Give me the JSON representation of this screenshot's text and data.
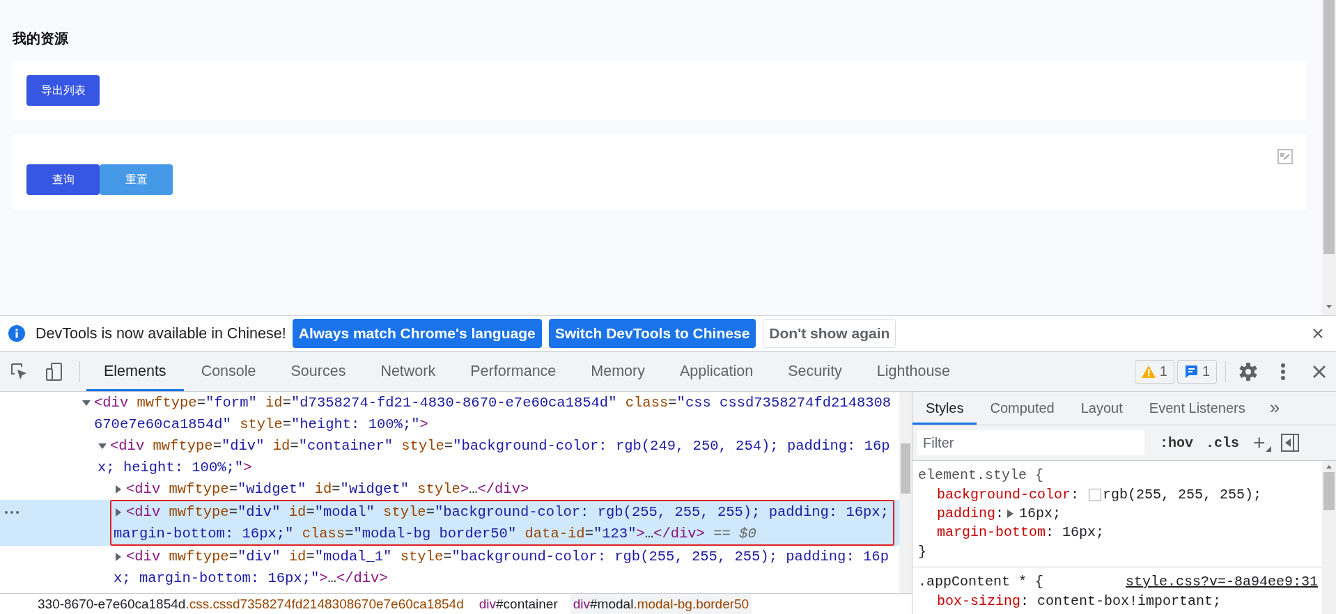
{
  "page": {
    "title": "我的资源",
    "toolbar_buttons": [
      {
        "label": "导出列表",
        "kind": "primary"
      }
    ],
    "search_panel": {
      "buttons": [
        {
          "label": "查询",
          "kind": "primary"
        },
        {
          "label": "重置",
          "kind": "secondary"
        }
      ]
    }
  },
  "devtools": {
    "banner": {
      "message": "DevTools is now available in Chinese!",
      "buttons": [
        {
          "label": "Always match Chrome's language",
          "kind": "primary"
        },
        {
          "label": "Switch DevTools to Chinese",
          "kind": "primary"
        },
        {
          "label": "Don't show again",
          "kind": "outline"
        }
      ]
    },
    "tabs": [
      {
        "label": "Elements",
        "selected": true
      },
      {
        "label": "Console",
        "selected": false
      },
      {
        "label": "Sources",
        "selected": false
      },
      {
        "label": "Network",
        "selected": false
      },
      {
        "label": "Performance",
        "selected": false
      },
      {
        "label": "Memory",
        "selected": false
      },
      {
        "label": "Application",
        "selected": false
      },
      {
        "label": "Security",
        "selected": false
      },
      {
        "label": "Lighthouse",
        "selected": false
      }
    ],
    "badges": [
      {
        "kind": "warning",
        "count": "1"
      },
      {
        "kind": "message",
        "count": "1"
      }
    ],
    "dom_tree": [
      {
        "expanded": true,
        "selected": false,
        "outlined": false,
        "lines": [
          [
            {
              "kind": "tag",
              "text": "<div"
            },
            {
              "kind": "attr",
              "text": " mwftype"
            },
            {
              "kind": "plain",
              "text": "="
            },
            {
              "kind": "value",
              "text": "\"form\""
            },
            {
              "kind": "attr",
              "text": " id"
            },
            {
              "kind": "plain",
              "text": "="
            },
            {
              "kind": "value",
              "text": "\"d7358274-fd21-4830-8670-e7e60ca1854d\""
            },
            {
              "kind": "attr",
              "text": " class"
            },
            {
              "kind": "plain",
              "text": "="
            },
            {
              "kind": "value",
              "text": "\"css cssd7358274fd2148308"
            }
          ],
          [
            {
              "kind": "value",
              "text": "670e7e60ca1854d\""
            },
            {
              "kind": "attr",
              "text": " style"
            },
            {
              "kind": "plain",
              "text": "="
            },
            {
              "kind": "value",
              "text": "\"height: 100%;\""
            },
            {
              "kind": "tag",
              "text": ">"
            }
          ]
        ],
        "children": [
          {
            "expanded": true,
            "selected": false,
            "outlined": false,
            "lines": [
              [
                {
                  "kind": "tag",
                  "text": "<div"
                },
                {
                  "kind": "attr",
                  "text": " mwftype"
                },
                {
                  "kind": "plain",
                  "text": "="
                },
                {
                  "kind": "value",
                  "text": "\"div\""
                },
                {
                  "kind": "attr",
                  "text": " id"
                },
                {
                  "kind": "plain",
                  "text": "="
                },
                {
                  "kind": "value",
                  "text": "\"container\""
                },
                {
                  "kind": "attr",
                  "text": " style"
                },
                {
                  "kind": "plain",
                  "text": "="
                },
                {
                  "kind": "value",
                  "text": "\"background-color: rgb(249, 250, 254); padding: 16p"
                }
              ],
              [
                {
                  "kind": "value",
                  "text": "x; height: 100%;\""
                },
                {
                  "kind": "tag",
                  "text": ">"
                }
              ]
            ],
            "children": [
              {
                "expanded": false,
                "selected": false,
                "outlined": false,
                "lines": [
                  [
                    {
                      "kind": "tag",
                      "text": "<div"
                    },
                    {
                      "kind": "attr",
                      "text": " mwftype"
                    },
                    {
                      "kind": "plain",
                      "text": "="
                    },
                    {
                      "kind": "value",
                      "text": "\"widget\""
                    },
                    {
                      "kind": "attr",
                      "text": " id"
                    },
                    {
                      "kind": "plain",
                      "text": "="
                    },
                    {
                      "kind": "value",
                      "text": "\"widget\""
                    },
                    {
                      "kind": "attr",
                      "text": " style"
                    },
                    {
                      "kind": "tag",
                      "text": ">"
                    },
                    {
                      "kind": "plain",
                      "text": "…"
                    },
                    {
                      "kind": "tag",
                      "text": "</div>"
                    }
                  ]
                ]
              },
              {
                "expanded": false,
                "selected": true,
                "outlined": true,
                "lines": [
                  [
                    {
                      "kind": "tag",
                      "text": "<div"
                    },
                    {
                      "kind": "attr",
                      "text": " mwftype"
                    },
                    {
                      "kind": "plain",
                      "text": "="
                    },
                    {
                      "kind": "value",
                      "text": "\"div\""
                    },
                    {
                      "kind": "attr",
                      "text": " id"
                    },
                    {
                      "kind": "plain",
                      "text": "="
                    },
                    {
                      "kind": "value",
                      "text": "\"modal\""
                    },
                    {
                      "kind": "attr",
                      "text": " style"
                    },
                    {
                      "kind": "plain",
                      "text": "="
                    },
                    {
                      "kind": "value",
                      "text": "\"background-color: rgb(255, 255, 255); padding: 16px;"
                    }
                  ],
                  [
                    {
                      "kind": "value",
                      "text": "margin-bottom: 16px;\""
                    },
                    {
                      "kind": "attr",
                      "text": " class"
                    },
                    {
                      "kind": "plain",
                      "text": "="
                    },
                    {
                      "kind": "value",
                      "text": "\"modal-bg border50\""
                    },
                    {
                      "kind": "attr",
                      "text": " data-id"
                    },
                    {
                      "kind": "plain",
                      "text": "="
                    },
                    {
                      "kind": "value",
                      "text": "\"123\""
                    },
                    {
                      "kind": "tag",
                      "text": ">"
                    },
                    {
                      "kind": "plain",
                      "text": "…"
                    },
                    {
                      "kind": "tag",
                      "text": "</div>"
                    },
                    {
                      "kind": "ref",
                      "text": " == $0"
                    }
                  ]
                ]
              },
              {
                "expanded": false,
                "selected": false,
                "outlined": false,
                "lines": [
                  [
                    {
                      "kind": "tag",
                      "text": "<div"
                    },
                    {
                      "kind": "attr",
                      "text": " mwftype"
                    },
                    {
                      "kind": "plain",
                      "text": "="
                    },
                    {
                      "kind": "value",
                      "text": "\"div\""
                    },
                    {
                      "kind": "attr",
                      "text": " id"
                    },
                    {
                      "kind": "plain",
                      "text": "="
                    },
                    {
                      "kind": "value",
                      "text": "\"modal_1\""
                    },
                    {
                      "kind": "attr",
                      "text": " style"
                    },
                    {
                      "kind": "plain",
                      "text": "="
                    },
                    {
                      "kind": "value",
                      "text": "\"background-color: rgb(255, 255, 255); padding: 16p"
                    }
                  ],
                  [
                    {
                      "kind": "value",
                      "text": "x; margin-bottom: 16px;\""
                    },
                    {
                      "kind": "tag",
                      "text": ">"
                    },
                    {
                      "kind": "plain",
                      "text": "…"
                    },
                    {
                      "kind": "tag",
                      "text": "</div>"
                    }
                  ]
                ]
              }
            ]
          }
        ]
      }
    ],
    "breadcrumbs": [
      {
        "id_part": "330-8670-e7e60ca1854d",
        "class_part": ".css.cssd7358274fd2148308670e7e60ca1854d",
        "selected": false
      },
      {
        "tag": "div",
        "id_part": "#container",
        "selected": false
      },
      {
        "tag": "div",
        "id_part": "#modal",
        "class_part": ".modal-bg.border50",
        "selected": true
      }
    ],
    "styles_pane": {
      "tabs": [
        {
          "label": "Styles",
          "selected": true
        },
        {
          "label": "Computed",
          "selected": false
        },
        {
          "label": "Layout",
          "selected": false
        },
        {
          "label": "Event Listeners",
          "selected": false
        }
      ],
      "more": "»",
      "filter": {
        "placeholder": "Filter"
      },
      "hov": ":hov",
      "cls": ".cls",
      "add": "+",
      "rules": [
        {
          "selector": "element.style {",
          "close": "}",
          "properties": [
            {
              "name": "background-color",
              "separator": ": ",
              "value": "rgb(255, 255, 255);",
              "swatch": true,
              "expandable": false
            },
            {
              "name": "padding",
              "separator": ":",
              "value": "16px;",
              "swatch": false,
              "expandable": true
            },
            {
              "name": "margin-bottom",
              "separator": ": ",
              "value": "16px;",
              "swatch": false,
              "expandable": false
            }
          ]
        },
        {
          "selector": ".appContent * {",
          "source": "style.css?v=-8a94ee9:31",
          "properties": [
            {
              "name": "box-sizing",
              "separator": ": ",
              "value": "content-box!important;",
              "swatch": false,
              "expandable": false
            }
          ]
        }
      ]
    }
  }
}
